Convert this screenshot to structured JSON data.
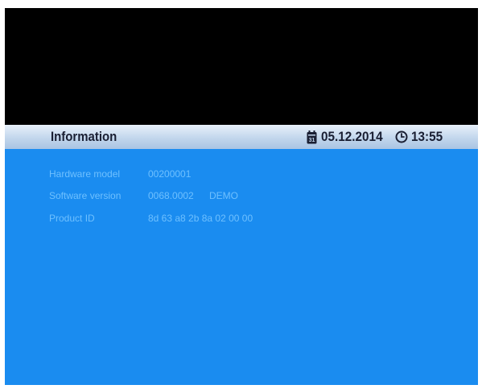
{
  "header": {
    "title": "Information",
    "date": "05.12.2014",
    "time": "13:55",
    "calendar_icon": "calendar-icon",
    "clock_icon": "clock-icon"
  },
  "info": {
    "rows": [
      {
        "label": "Hardware model",
        "value": "00200001",
        "extra": ""
      },
      {
        "label": "Software version",
        "value": "0068.0002",
        "extra": "DEMO"
      },
      {
        "label": "Product ID",
        "value": "8d 63 a8 2b 8a 02 00 00",
        "extra": ""
      }
    ]
  },
  "colors": {
    "panel": "#1a8cf0",
    "header_bar": "#c2d6ec",
    "text_dim": "#6ec0ff",
    "screen_bg": "#000000"
  }
}
